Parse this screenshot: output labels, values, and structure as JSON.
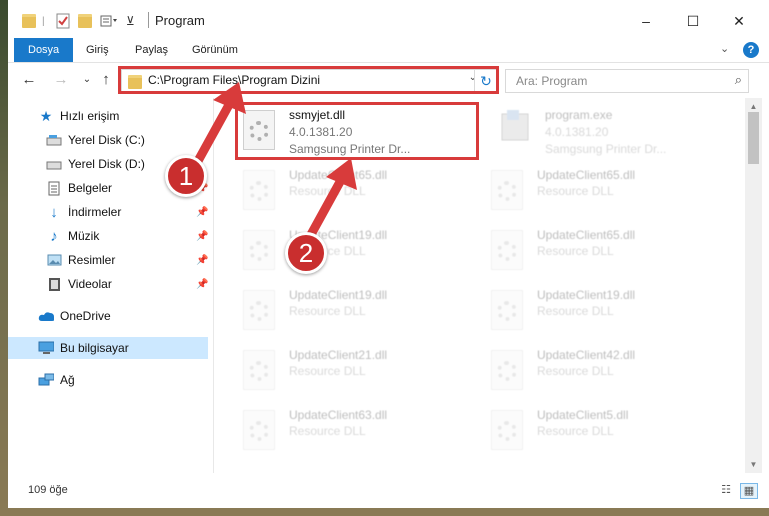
{
  "window": {
    "title": "Program",
    "controls": {
      "minimize": "–",
      "maximize": "☐",
      "close": "✕"
    }
  },
  "ribbon": {
    "tabs": [
      {
        "label": "Dosya",
        "active": true
      },
      {
        "label": "Giriş"
      },
      {
        "label": "Paylaş"
      },
      {
        "label": "Görünüm"
      }
    ],
    "expand": "⌄",
    "help": "?"
  },
  "nav": {
    "back": "←",
    "forward": "→",
    "recent": "⌄",
    "up": "↑",
    "address": "C:\\Program Files\\Program Dizini",
    "address_dropdown": "⌄",
    "refresh": "↻",
    "search_placeholder": "Ara: Program",
    "search_icon": "⌕"
  },
  "sidebar": {
    "items": [
      {
        "label": "Hızlı erişim",
        "icon": "star-icon"
      },
      {
        "label": "Yerel Disk (C:)",
        "icon": "drive-icon",
        "pinned": true
      },
      {
        "label": "Yerel Disk (D:)",
        "icon": "drive-icon",
        "pinned": true
      },
      {
        "label": "Belgeler",
        "icon": "documents-icon",
        "pinned": true
      },
      {
        "label": "İndirmeler",
        "icon": "download-icon",
        "pinned": true
      },
      {
        "label": "Müzik",
        "icon": "music-icon",
        "pinned": true
      },
      {
        "label": "Resimler",
        "icon": "pictures-icon",
        "pinned": true
      },
      {
        "label": "Videolar",
        "icon": "videos-icon",
        "pinned": true
      },
      {
        "label": "OneDrive",
        "icon": "cloud-icon"
      },
      {
        "label": "Bu bilgisayar",
        "icon": "computer-icon",
        "selected": true
      },
      {
        "label": "Ağ",
        "icon": "network-icon"
      }
    ],
    "pin_glyph": "📌"
  },
  "files": {
    "highlighted": {
      "name": "ssmyjet.dll",
      "version": "4.0.1381.20",
      "description": "Samgsung Printer Dr..."
    },
    "program_exe": {
      "name": "program.exe",
      "version": "4.0.1381.20",
      "description": "Samgsung Printer Dr..."
    },
    "grid": [
      [
        {
          "name": "UpdateClient65.dll",
          "type": "Resource DLL"
        },
        {
          "name": "UpdateClient65.dll",
          "type": "Resource DLL"
        }
      ],
      [
        {
          "name": "UpdateClient19.dll",
          "type": "Resource DLL"
        },
        {
          "name": "UpdateClient65.dll",
          "type": "Resource DLL"
        }
      ],
      [
        {
          "name": "UpdateClient19.dll",
          "type": "Resource DLL"
        },
        {
          "name": "UpdateClient19.dll",
          "type": "Resource DLL"
        }
      ],
      [
        {
          "name": "UpdateClient21.dll",
          "type": "Resource DLL"
        },
        {
          "name": "UpdateClient42.dll",
          "type": "Resource DLL"
        }
      ],
      [
        {
          "name": "UpdateClient63.dll",
          "type": "Resource DLL"
        },
        {
          "name": "UpdateClient5.dll",
          "type": "Resource DLL"
        }
      ]
    ]
  },
  "status": {
    "count": "109 öğe"
  },
  "annotations": {
    "step1": "1",
    "step2": "2",
    "color": "#d83b3b"
  }
}
